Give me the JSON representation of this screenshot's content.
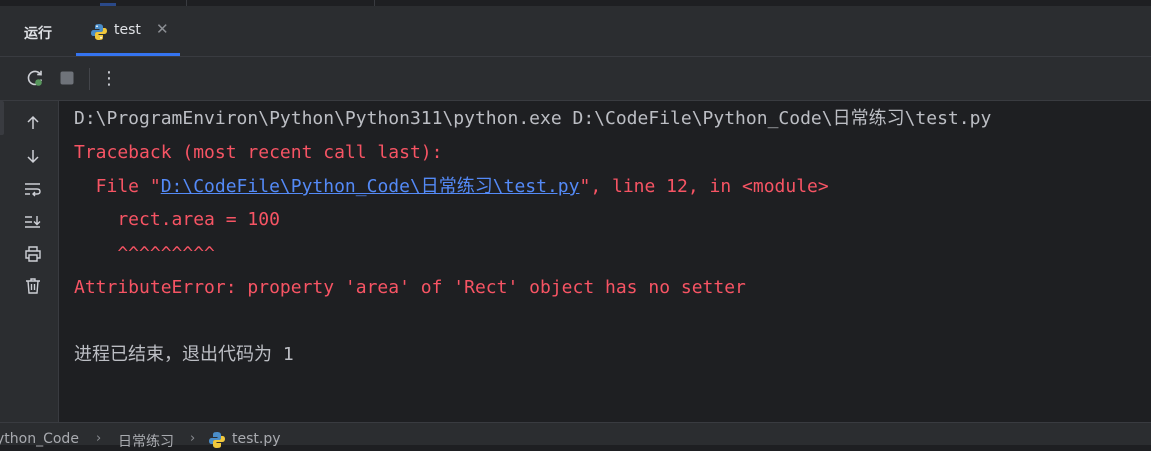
{
  "run_panel": {
    "title": "运行",
    "tab": {
      "label": "test",
      "close_glyph": "✕",
      "icon": "python-file-icon"
    }
  },
  "toolbar": {
    "rerun_icon": "rerun-icon",
    "stop_icon": "stop-icon",
    "more_glyph": "⋮"
  },
  "gutter": {
    "icons": [
      "arrow-up-icon",
      "arrow-down-icon",
      "soft-wrap-icon",
      "scroll-to-end-icon",
      "print-icon",
      "trash-icon"
    ]
  },
  "console": {
    "command": "D:\\ProgramEnviron\\Python\\Python311\\python.exe D:\\CodeFile\\Python_Code\\日常练习\\test.py",
    "traceback_header": "Traceback (most recent call last):",
    "file_prefix": "  File \"",
    "file_link": "D:\\CodeFile\\Python_Code\\日常练习\\test.py",
    "file_suffix": "\", line 12, in <module>",
    "code_line": "    rect.area = 100",
    "caret_line": "    ^^^^^^^^^",
    "error_line": "AttributeError: property 'area' of 'Rect' object has no setter",
    "exit_text": "进程已结束，退出代码为 ",
    "exit_code": "1"
  },
  "breadcrumb": {
    "items": [
      "ython_Code",
      "日常练习",
      "test.py"
    ],
    "separator": "›"
  },
  "colors": {
    "background": "#1e1f22",
    "panel": "#2b2d30",
    "error": "#f75464",
    "link": "#548af7",
    "accent": "#3574f0"
  }
}
